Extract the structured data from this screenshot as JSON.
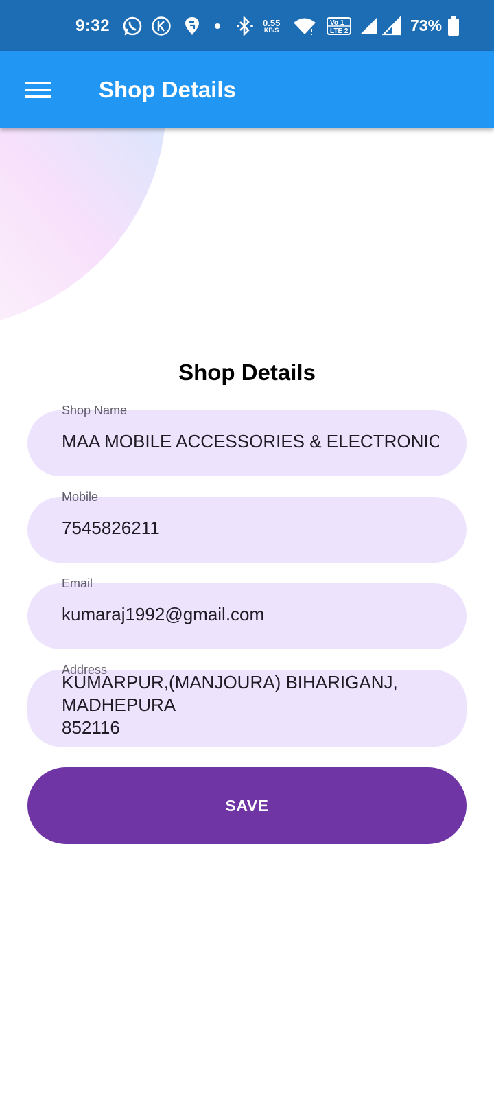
{
  "status_bar": {
    "time": "9:32",
    "net_speed_value": "0.55",
    "net_speed_unit": "KB/S",
    "volte_top": "Vo",
    "volte_bottom": "LTE",
    "battery_percent": "73%",
    "icons": [
      "whatsapp-icon",
      "k-app-icon",
      "swiggy-icon",
      "notification-dot-icon",
      "bluetooth-icon",
      "wifi-icon",
      "volte-icon",
      "signal-icon",
      "signal-icon",
      "battery-icon"
    ]
  },
  "app_bar": {
    "title": "Shop Details",
    "menu_icon": "menu-icon",
    "color": "#2196f3"
  },
  "form": {
    "title": "Shop Details",
    "fields": [
      {
        "label": "Shop Name",
        "value": "MAA MOBILE ACCESSORIES & ELECTRONICS"
      },
      {
        "label": "Mobile",
        "value": "7545826211"
      },
      {
        "label": "Email",
        "value": "kumaraj1992@gmail.com"
      },
      {
        "label": "Address",
        "value": "KUMARPUR,(MANJOURA) BIHARIGANJ,\nMADHEPURA\n852116"
      }
    ],
    "field_background": "#ede3fd",
    "save_label": "SAVE",
    "save_color": "#6f35a5"
  }
}
